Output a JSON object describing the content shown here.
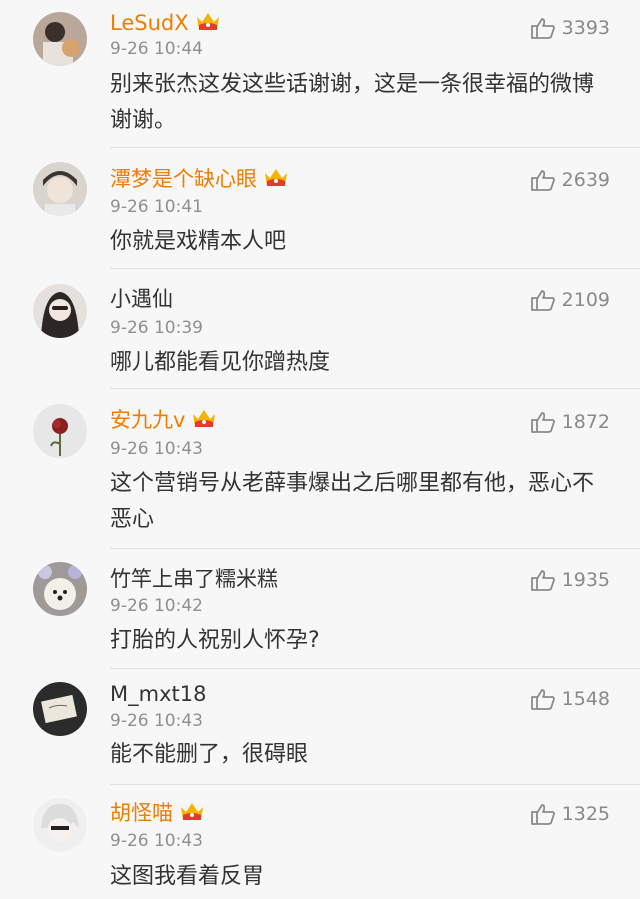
{
  "comments": [
    {
      "name": "LeSudX",
      "vip": true,
      "time": "9-26 10:44",
      "text": "别来张杰这发这些话谢谢，这是一条很幸福的微博谢谢。",
      "likes": "3393"
    },
    {
      "name": "潭梦是个缺心眼",
      "vip": true,
      "time": "9-26 10:41",
      "text": "你就是戏精本人吧",
      "likes": "2639"
    },
    {
      "name": "小遇仙",
      "vip": false,
      "time": "9-26 10:39",
      "text": "哪儿都能看见你蹭热度",
      "likes": "2109"
    },
    {
      "name": "安九九v",
      "vip": true,
      "time": "9-26 10:43",
      "text": "这个营销号从老薛事爆出之后哪里都有他，恶心不恶心",
      "likes": "1872"
    },
    {
      "name": "竹竿上串了糯米糕",
      "vip": false,
      "time": "9-26 10:42",
      "text": "打胎的人祝别人怀孕?",
      "likes": "1935"
    },
    {
      "name": "M_mxt18",
      "vip": false,
      "time": "9-26 10:43",
      "text": "能不能删了，很碍眼",
      "likes": "1548"
    },
    {
      "name": "胡怪喵",
      "vip": true,
      "time": "9-26 10:43",
      "text": "这图我看着反胃",
      "likes": "1325"
    }
  ],
  "icons": {
    "like": "thumbs-up-icon",
    "vip": "crown-icon"
  },
  "colors": {
    "vip_name": "#f07d00",
    "text": "#333333",
    "meta": "#8f8f8f",
    "background": "#f7f7f7"
  }
}
